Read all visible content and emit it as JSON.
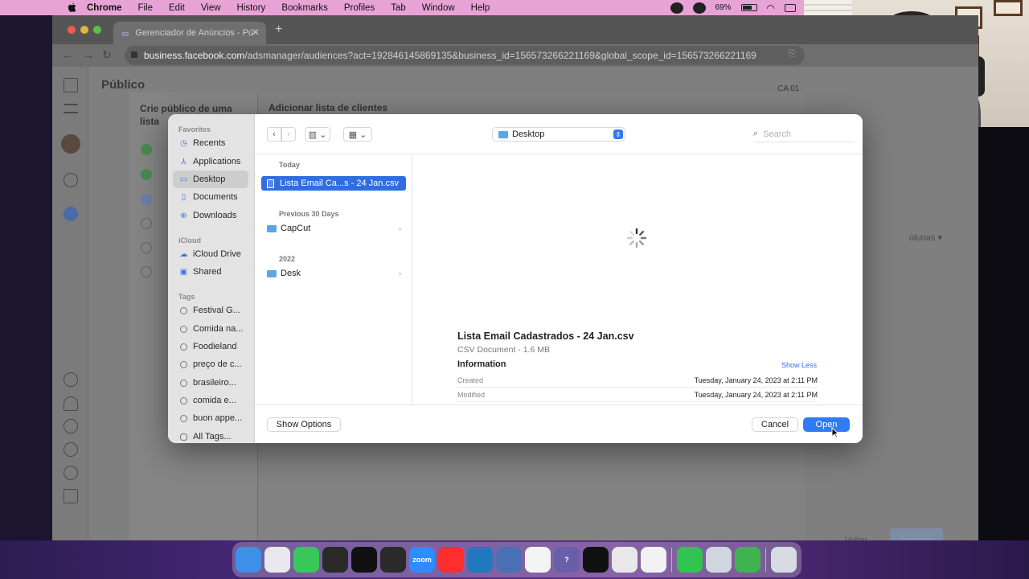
{
  "menubar": {
    "app_name": "Chrome",
    "items": [
      "File",
      "Edit",
      "View",
      "History",
      "Bookmarks",
      "Profiles",
      "Tab",
      "Window",
      "Help"
    ],
    "battery": "69%"
  },
  "browser": {
    "tab_title": "Gerenciador de Anúncios - Pú",
    "url_host": "business.facebook.com",
    "url_path": "/adsmanager/audiences?act=192846145869135&business_id=156573266221169&global_scope_id=156573266221169"
  },
  "page": {
    "title": "Público",
    "account_badge": "CA 01",
    "modal_left_title": "Crie público de uma lista",
    "modal_main_title": "Adicionar lista de clientes",
    "back_button": "Voltar",
    "next_button": "Avançar",
    "columns_label": "olunas"
  },
  "dialog": {
    "sidebar": {
      "favorites_header": "Favorites",
      "favorites": [
        {
          "label": "Recents",
          "icon": "clock-icon"
        },
        {
          "label": "Applications",
          "icon": "applications-icon"
        },
        {
          "label": "Desktop",
          "icon": "desktop-icon",
          "selected": true
        },
        {
          "label": "Documents",
          "icon": "document-icon"
        },
        {
          "label": "Downloads",
          "icon": "download-icon"
        }
      ],
      "icloud_header": "iCloud",
      "icloud": [
        {
          "label": "iCloud Drive",
          "icon": "cloud-icon"
        },
        {
          "label": "Shared",
          "icon": "shared-folder-icon"
        }
      ],
      "tags_header": "Tags",
      "tags": [
        "Festival G...",
        "Comida na...",
        "Foodieland",
        "preço de c...",
        "brasileiro...",
        "comida e...",
        "buon appe...",
        "All Tags..."
      ]
    },
    "location": "Desktop",
    "search_placeholder": "Search",
    "groups": [
      {
        "header": "Today",
        "items": [
          {
            "name": "Lista Email Ca...s - 24 Jan.csv",
            "type": "file",
            "selected": true
          }
        ]
      },
      {
        "header": "Previous 30 Days",
        "items": [
          {
            "name": "CapCut",
            "type": "folder"
          }
        ]
      },
      {
        "header": "2022",
        "items": [
          {
            "name": "Desk",
            "type": "folder"
          }
        ]
      }
    ],
    "preview": {
      "filename": "Lista Email Cadastrados - 24 Jan.csv",
      "kind": "CSV Document - 1.6 MB",
      "info_title": "Information",
      "show_less": "Show Less",
      "created_label": "Created",
      "created_value": "Tuesday, January 24, 2023 at 2:11 PM",
      "modified_label": "Modified",
      "modified_value": "Tuesday, January 24, 2023 at 2:11 PM"
    },
    "show_options": "Show Options",
    "cancel": "Cancel",
    "open": "Open"
  },
  "dock": {
    "apps": [
      {
        "name": "finder-icon",
        "color": "#3d8fe8",
        "label": ""
      },
      {
        "name": "launchpad-icon",
        "color": "#e8e8ee",
        "label": ""
      },
      {
        "name": "messages-icon",
        "color": "#38c85a",
        "label": ""
      },
      {
        "name": "claquete-icon",
        "color": "#2a2a2a",
        "label": ""
      },
      {
        "name": "capcut-icon",
        "color": "#111111",
        "label": ""
      },
      {
        "name": "obs-icon",
        "color": "#2b2b2b",
        "label": ""
      },
      {
        "name": "zoom-icon",
        "color": "#2d8cff",
        "label": "zoom"
      },
      {
        "name": "youtube-icon",
        "color": "#ff2d2d",
        "label": ""
      },
      {
        "name": "trello-icon",
        "color": "#1f79bf",
        "label": ""
      },
      {
        "name": "teams-icon",
        "color": "#4b6fb5",
        "label": ""
      },
      {
        "name": "slack-icon",
        "color": "#f3f3f3",
        "label": ""
      },
      {
        "name": "help-icon",
        "color": "#6b5ea8",
        "label": "?"
      },
      {
        "name": "vpn-icon",
        "color": "#111111",
        "label": ""
      },
      {
        "name": "chrome-icon",
        "color": "#e8e8e8",
        "label": ""
      },
      {
        "name": "brave-icon",
        "color": "#f2f2f2",
        "label": ""
      },
      {
        "name": "whatsapp-icon",
        "color": "#31c450",
        "label": ""
      },
      {
        "name": "quicktime-icon",
        "color": "#cfd6e0",
        "label": ""
      },
      {
        "name": "numbers-icon",
        "color": "#3fb34f",
        "label": ""
      },
      {
        "name": "trash-icon",
        "color": "#d7dbe2",
        "label": ""
      }
    ]
  }
}
